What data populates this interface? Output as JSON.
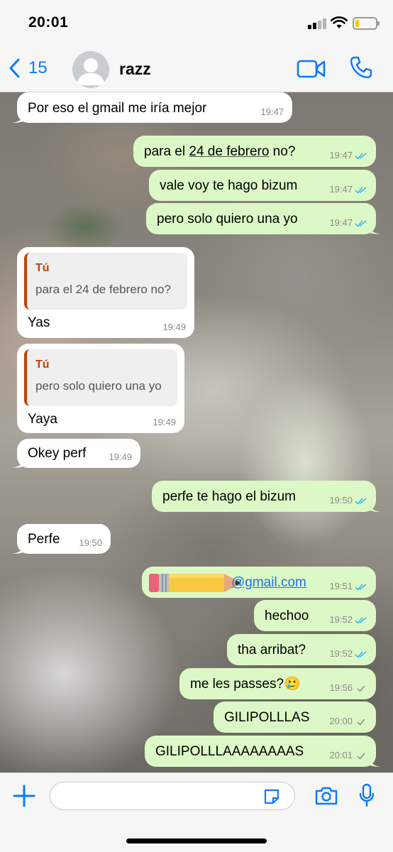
{
  "status_bar": {
    "time": "20:01"
  },
  "header": {
    "back_count": "15",
    "contact_name": "razz"
  },
  "colors": {
    "accent": "#0a7aff",
    "outgoing_bubble": "#dcf8c6",
    "incoming_bubble": "#ffffff",
    "quote_author": "#c2410c",
    "read_ticks": "#34b7f1"
  },
  "messages": [
    {
      "dir": "in",
      "text": "Por eso el gmail me iría mejor",
      "time": "19:47"
    },
    {
      "dir": "out",
      "text_before": "para el ",
      "text_underlined": "24 de febrero",
      "text_after": " no?",
      "time": "19:47",
      "ticks": "read"
    },
    {
      "dir": "out",
      "text": "vale voy te hago bizum",
      "time": "19:47",
      "ticks": "read"
    },
    {
      "dir": "out",
      "text": "pero solo quiero una yo",
      "time": "19:47",
      "ticks": "read"
    },
    {
      "dir": "in",
      "quote_author": "Tú",
      "quote_text": "para el 24 de febrero no?",
      "text": "Yas",
      "time": "19:49"
    },
    {
      "dir": "in",
      "quote_author": "Tú",
      "quote_text": "pero solo quiero una yo",
      "text": "Yaya",
      "time": "19:49"
    },
    {
      "dir": "in",
      "text": "Okey perf",
      "time": "19:49"
    },
    {
      "dir": "out",
      "text": "perfe te hago el bizum",
      "time": "19:50",
      "ticks": "read"
    },
    {
      "dir": "in",
      "text": "Perfe",
      "time": "19:50"
    },
    {
      "dir": "out",
      "text": "@gmail.com",
      "time": "19:51",
      "ticks": "read"
    },
    {
      "dir": "out",
      "text": "hechoo",
      "time": "19:52",
      "ticks": "read"
    },
    {
      "dir": "out",
      "text": "tha arribat?",
      "time": "19:52",
      "ticks": "read"
    },
    {
      "dir": "out",
      "text": "me les passes?🥲",
      "time": "19:56",
      "ticks": "sent"
    },
    {
      "dir": "out",
      "text": "GILIPOLLLAS",
      "time": "20:00",
      "ticks": "sent"
    },
    {
      "dir": "out",
      "text": "GILIPOLLLAAAAAAAAS",
      "time": "20:01",
      "ticks": "sent"
    }
  ],
  "input": {
    "placeholder": ""
  }
}
